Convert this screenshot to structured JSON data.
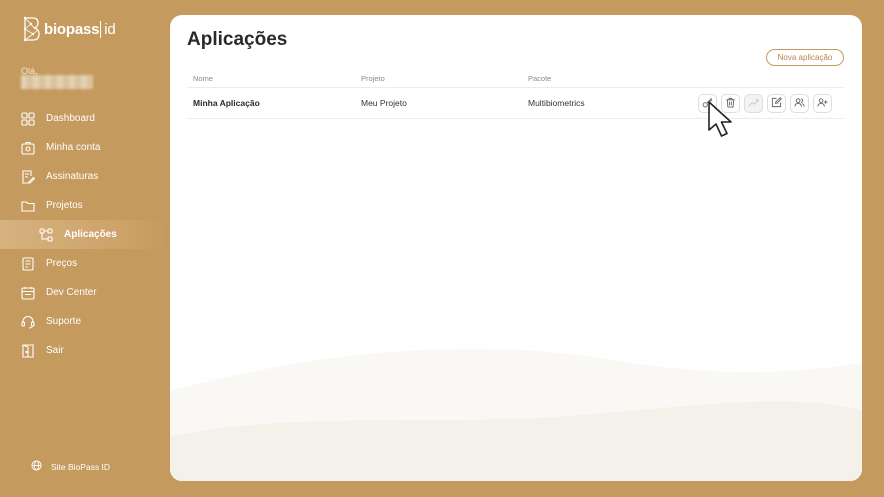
{
  "brand": {
    "name": "biopass",
    "suffix": "id"
  },
  "user": {
    "greeting": "Olá,"
  },
  "nav": {
    "items": [
      {
        "label": "Dashboard",
        "icon": "grid-icon"
      },
      {
        "label": "Minha conta",
        "icon": "id-card-icon"
      },
      {
        "label": "Assinaturas",
        "icon": "document-edit-icon"
      },
      {
        "label": "Projetos",
        "icon": "folder-icon"
      },
      {
        "label": "Aplicações",
        "icon": "hierarchy-icon",
        "active": true,
        "sub": true
      },
      {
        "label": "Preços",
        "icon": "price-list-icon"
      },
      {
        "label": "Dev Center",
        "icon": "calendar-icon"
      },
      {
        "label": "Suporte",
        "icon": "headset-icon"
      },
      {
        "label": "Sair",
        "icon": "exit-door-icon"
      }
    ],
    "site_link": "Site BioPass ID"
  },
  "main": {
    "title": "Aplicações",
    "new_button": "Nova aplicação",
    "table": {
      "headers": [
        "Nome",
        "Projeto",
        "Pacote"
      ],
      "rows": [
        {
          "nome": "Minha Aplicação",
          "projeto": "Meu Projeto",
          "pacote": "Multibiometrics"
        }
      ],
      "actions": [
        "key-icon",
        "trash-icon",
        "trend-chart-icon",
        "edit-icon",
        "users-icon",
        "add-user-icon"
      ]
    }
  },
  "colors": {
    "sidebar": "#c49a5e",
    "accent": "#b8874a",
    "panel": "#ffffff"
  }
}
